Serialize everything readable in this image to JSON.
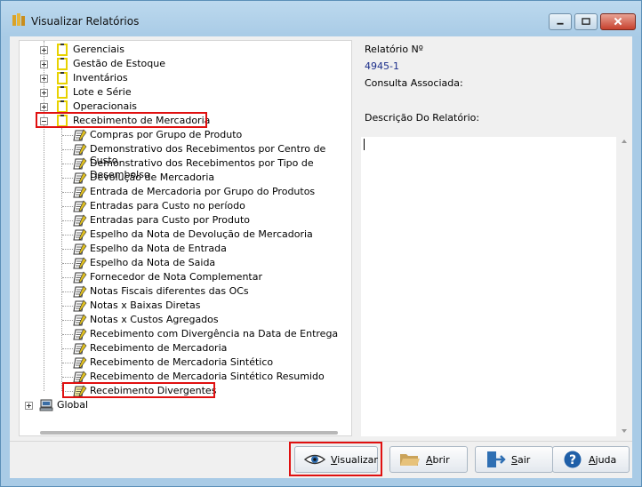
{
  "window": {
    "title": "Visualizar Relatórios",
    "controls": {
      "minimize": "minimize-icon",
      "maximize": "maximize-icon",
      "close": "close-icon"
    }
  },
  "tree": {
    "top_nodes": [
      {
        "label": "Gerenciais",
        "icon": "report-folder-icon",
        "expander": "+"
      },
      {
        "label": "Gestão de Estoque",
        "icon": "report-folder-icon",
        "expander": "+"
      },
      {
        "label": "Inventários",
        "icon": "report-folder-icon",
        "expander": "+"
      },
      {
        "label": "Lote e Série",
        "icon": "report-folder-icon",
        "expander": "+"
      },
      {
        "label": "Operacionais",
        "icon": "report-folder-icon",
        "expander": "+"
      },
      {
        "label": "Recebimento de Mercadoria",
        "icon": "report-folder-icon",
        "expander": "−"
      }
    ],
    "children": [
      "Compras por Grupo de Produto",
      "Demonstrativo dos Recebimentos por Centro de Custo",
      "Demonstrativo dos Recebimentos por Tipo de Desembolso",
      "Devolução de Mercadoria",
      "Entrada de Mercadoria por Grupo do Produtos",
      "Entradas para Custo no período",
      "Entradas para Custo por Produto",
      "Espelho da Nota de Devolução de Mercadoria",
      "Espelho da Nota de Entrada",
      "Espelho da Nota de Saida",
      "Fornecedor de Nota Complementar",
      "Notas Fiscais diferentes das OCs",
      "Notas x Baixas Diretas",
      "Notas x Custos Agregados",
      "Recebimento com Divergência na Data de Entrega",
      "Recebimento de Mercadoria",
      "Recebimento de Mercadoria Sintético",
      "Recebimento de Mercadoria Sintético Resumido",
      "Recebimento Divergentes"
    ],
    "selected": "Recebimento Divergentes",
    "bottom_node": {
      "label": "Global",
      "icon": "computer-icon",
      "expander": "+"
    },
    "highlight_color": "#e01010"
  },
  "details": {
    "report_number_label": "Relatório Nº",
    "report_number_value": "4945-1",
    "query_label": "Consulta Associada:",
    "description_label": "Descrição Do Relatório:",
    "value_color": "#1a2d8a"
  },
  "buttons": {
    "view": {
      "label": "Visualizar",
      "icon": "eye-icon"
    },
    "open": {
      "label": "Abrir",
      "icon": "folder-open-icon"
    },
    "exit": {
      "label": "Sair",
      "icon": "exit-door-icon"
    },
    "help": {
      "label": "Ajuda",
      "icon": "help-icon"
    }
  }
}
